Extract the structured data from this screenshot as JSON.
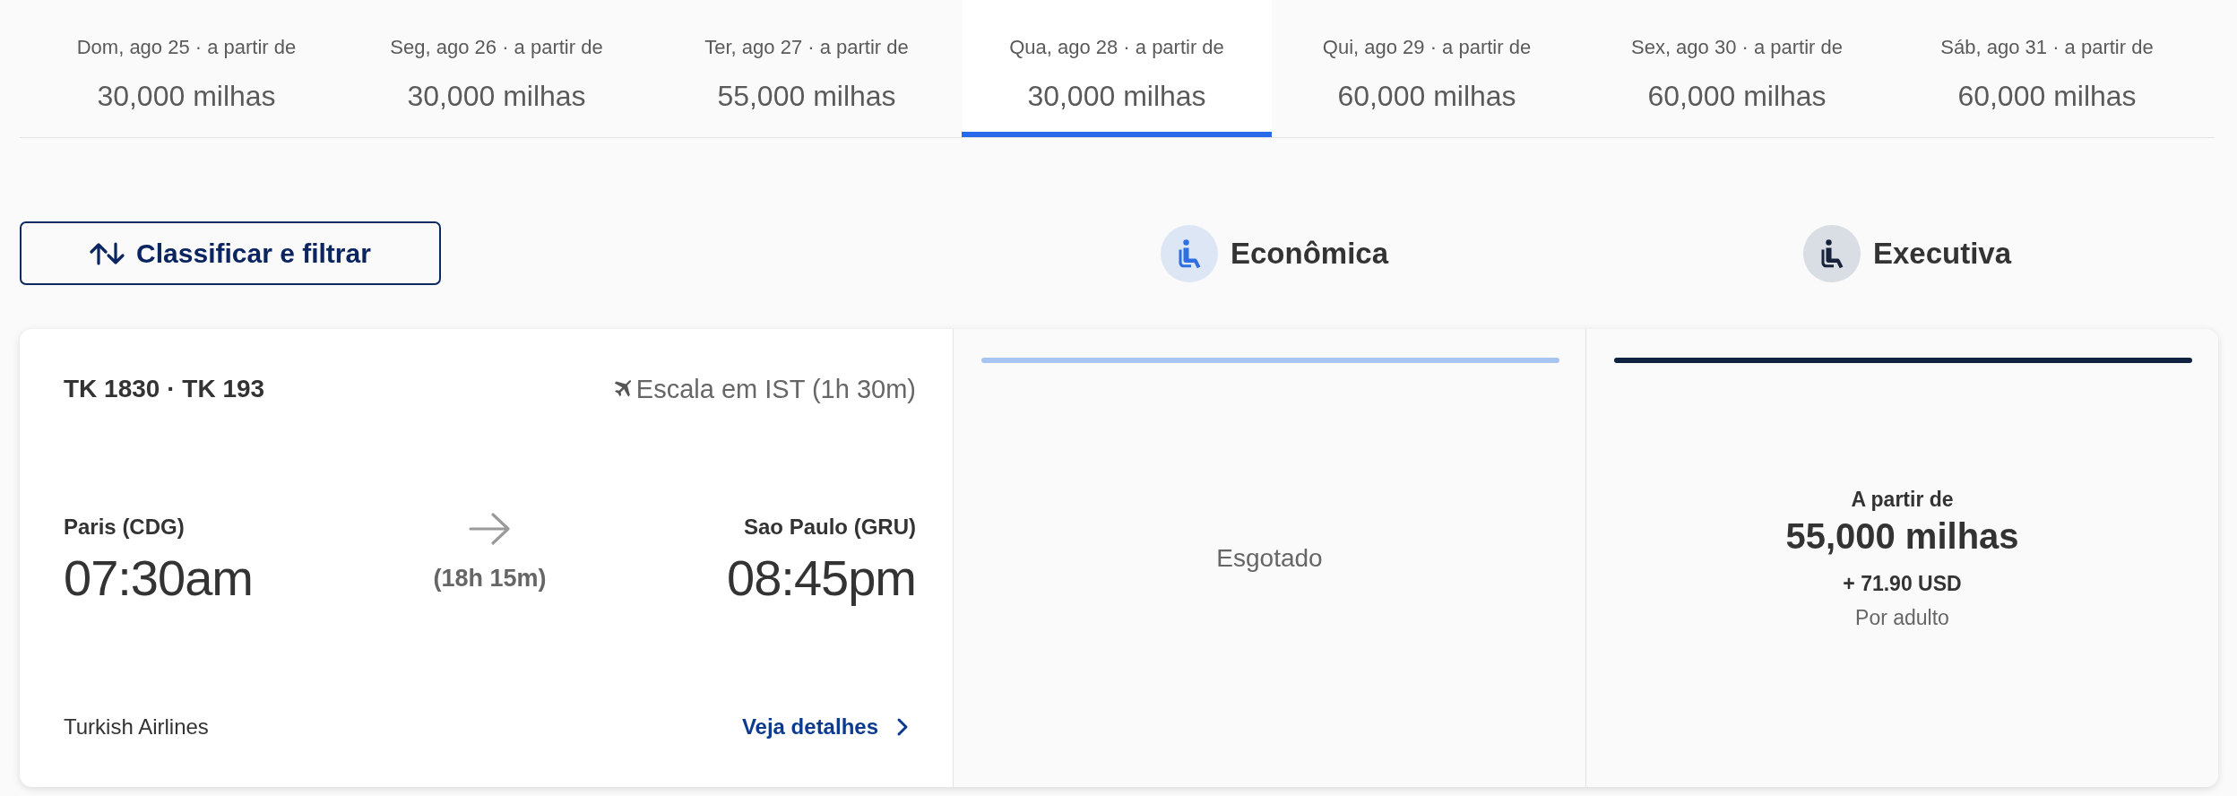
{
  "date_tabs": [
    {
      "date": "Dom, ago 25 · a partir de",
      "price": "30,000 milhas",
      "selected": false
    },
    {
      "date": "Seg, ago 26 · a partir de",
      "price": "30,000 milhas",
      "selected": false
    },
    {
      "date": "Ter, ago 27 · a partir de",
      "price": "55,000 milhas",
      "selected": false
    },
    {
      "date": "Qua, ago 28 · a partir de",
      "price": "30,000 milhas",
      "selected": true
    },
    {
      "date": "Qui, ago 29 · a partir de",
      "price": "60,000 milhas",
      "selected": false
    },
    {
      "date": "Sex, ago 30 · a partir de",
      "price": "60,000 milhas",
      "selected": false
    },
    {
      "date": "Sáb, ago 31 · a partir de",
      "price": "60,000 milhas",
      "selected": false
    }
  ],
  "filter_button": "Classificar e filtrar",
  "flight": {
    "flight_numbers": "TK 1830 · TK 193",
    "stop": "Escala em IST (1h 30m)",
    "origin": {
      "city": "Paris (CDG)",
      "time": "07:30am"
    },
    "duration": "(18h 15m)",
    "destination": {
      "city": "Sao Paulo (GRU)",
      "time": "08:45pm"
    },
    "airline": "Turkish Airlines",
    "details_link": "Veja detalhes"
  },
  "cabins": [
    {
      "kind": "economy",
      "label": "Econômica",
      "fare": {
        "kind": "sold_out",
        "status": "Esgotado"
      }
    },
    {
      "kind": "business",
      "label": "Executiva",
      "fare": {
        "kind": "price",
        "label": "A partir de",
        "price": "55,000 milhas",
        "taxes": "+ 71.90 USD",
        "note": "Por adulto"
      }
    }
  ]
}
